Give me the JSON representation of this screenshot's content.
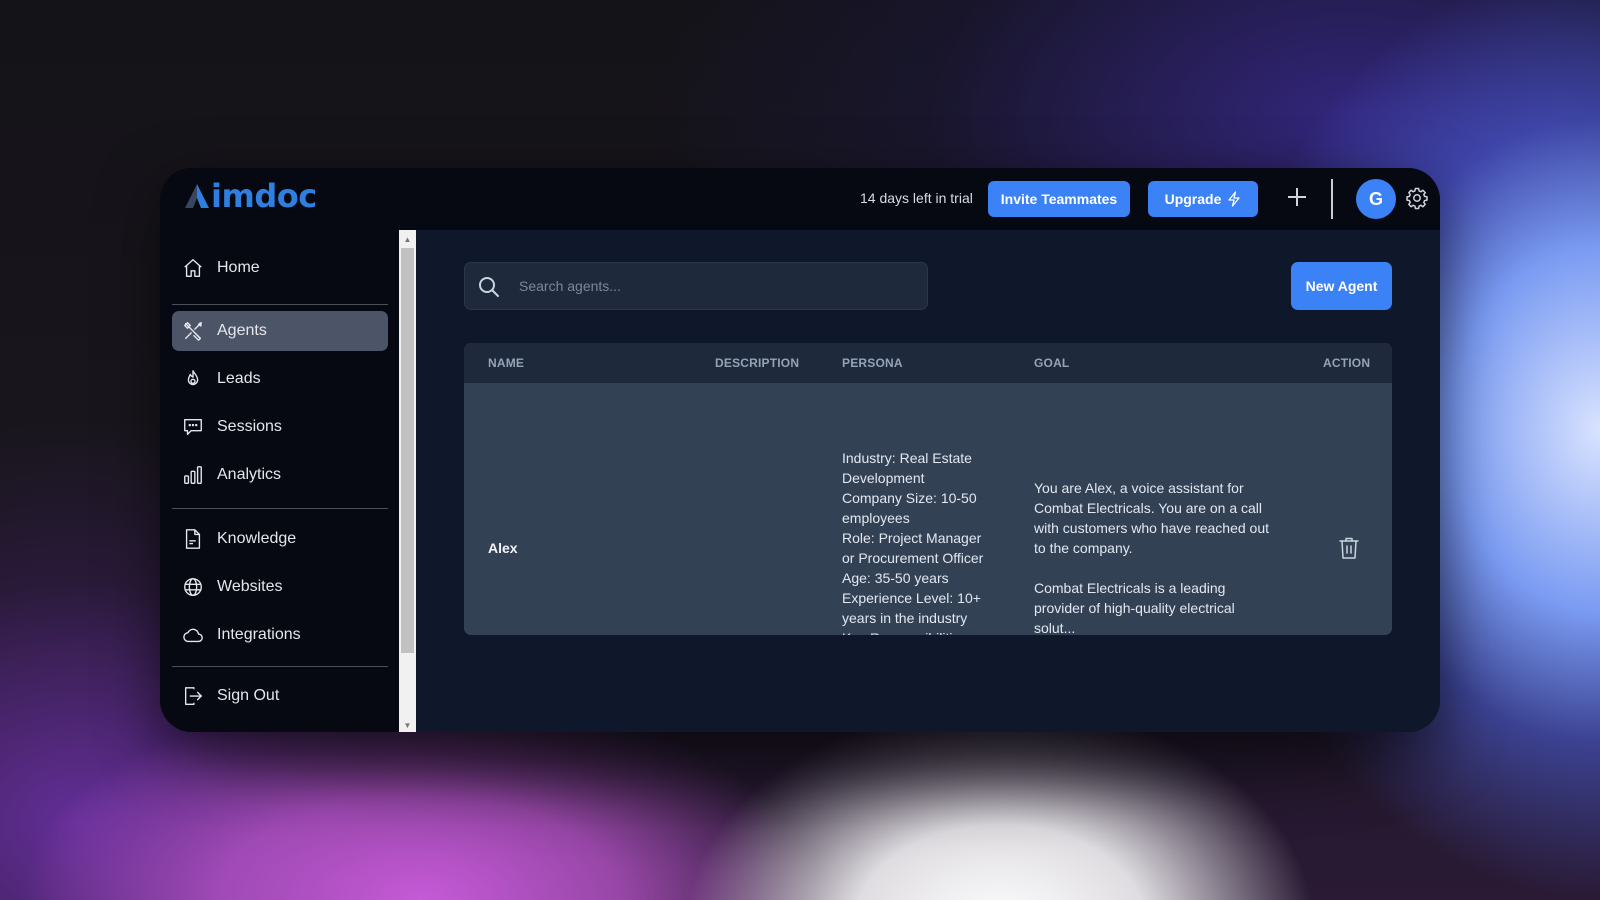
{
  "app": {
    "brand": "imdoc",
    "colors": {
      "accent": "#3b82f6",
      "brand": "#2f7fe0",
      "sidebar_bg": "#060812",
      "main_bg": "#0f172a",
      "row_bg": "#334155",
      "header_bg": "#1e293b"
    }
  },
  "header": {
    "trial_text": "14 days left in trial",
    "invite_label": "Invite Teammates",
    "upgrade_label": "Upgrade",
    "upgrade_icon": "lightning-icon",
    "add_icon": "plus-icon",
    "avatar_initial": "G",
    "settings_icon": "gear-icon"
  },
  "sidebar": {
    "items": [
      {
        "label": "Home",
        "icon": "home-icon",
        "active": false
      },
      {
        "label": "Agents",
        "icon": "tools-icon",
        "active": true
      },
      {
        "label": "Leads",
        "icon": "flame-icon",
        "active": false
      },
      {
        "label": "Sessions",
        "icon": "chat-icon",
        "active": false
      },
      {
        "label": "Analytics",
        "icon": "bar-chart-icon",
        "active": false
      },
      {
        "label": "Knowledge",
        "icon": "document-icon",
        "active": false
      },
      {
        "label": "Websites",
        "icon": "globe-icon",
        "active": false
      },
      {
        "label": "Integrations",
        "icon": "cloud-icon",
        "active": false
      },
      {
        "label": "Sign Out",
        "icon": "sign-out-icon",
        "active": false
      }
    ]
  },
  "main": {
    "search": {
      "placeholder": "Search agents...",
      "value": ""
    },
    "new_agent_label": "New Agent",
    "table": {
      "columns": [
        "NAME",
        "DESCRIPTION",
        "PERSONA",
        "GOAL",
        "ACTION"
      ],
      "rows": [
        {
          "name": "Alex",
          "description": "",
          "persona": "Industry: Real Estate\nDevelopment\nCompany Size: 10-50\nemployees\nRole: Project Manager\nor Procurement Officer\nAge: 35-50 years\nExperience Level: 10+\nyears in the industry\nKey Responsibilities:\nOverseei...",
          "goal": "You are Alex, a voice assistant for Combat Electricals. You are on a call with customers who have reached out to the company.\n\nCombat Electricals is a leading provider of high-quality electrical solut...",
          "action_icon": "trash-icon"
        }
      ]
    }
  }
}
